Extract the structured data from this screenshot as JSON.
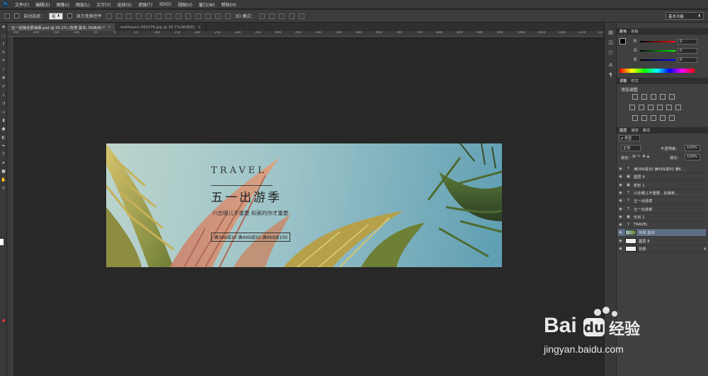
{
  "menubar": {
    "items": [
      "文件(F)",
      "编辑(E)",
      "图像(I)",
      "图层(L)",
      "文字(Y)",
      "选择(S)",
      "滤镜(T)",
      "3D(D)",
      "视图(V)",
      "窗口(W)",
      "帮助(H)"
    ]
  },
  "options_bar": {
    "auto_select_label": "自动选择：",
    "auto_select_value": "组",
    "show_transform_label": "显示变换控件",
    "mode_3d_label": "3D 模式：",
    "workspace": "基本功能"
  },
  "tabs": [
    {
      "label": "五一促销全屏海报.psd @ 55.1% (背景 副本, RGB/8) *",
      "active": true
    },
    {
      "label": "wallhaven-563276.jpg @ 16.7%(RGB/8)",
      "active": false
    }
  ],
  "ruler_ticks": [
    "250",
    "200",
    "150",
    "100",
    "50",
    "0",
    "50",
    "100",
    "150",
    "200",
    "250",
    "300",
    "350",
    "400",
    "450",
    "500",
    "550",
    "600",
    "650",
    "700",
    "750",
    "800",
    "850",
    "900",
    "950",
    "1000",
    "1050",
    "1100",
    "1150",
    "1200"
  ],
  "banner": {
    "travel": "TRAVEL",
    "title": "五一出游季",
    "subtitle": "川志哪儿不重要 和美的你才重要",
    "promo": "满399减30 满499减50 满699减100"
  },
  "panels": {
    "color_tabs": [
      "颜色",
      "色板"
    ],
    "rgb": [
      {
        "label": "R",
        "value": "0"
      },
      {
        "label": "G",
        "value": "0"
      },
      {
        "label": "B",
        "value": "0"
      }
    ],
    "adjust_tabs": [
      "调整",
      "样式"
    ],
    "adjust_title": "添加调整",
    "layers_tabs": [
      "图层",
      "通道",
      "路径"
    ],
    "filter_label": "类型",
    "blend_mode": "正常",
    "opacity_label": "不透明度：",
    "opacity_value": "100%",
    "lock_label": "锁定：",
    "fill_label": "填充：",
    "fill_value": "100%",
    "layers": [
      {
        "type": "T",
        "name": "满399减30 满499减50 满6...",
        "selected": false
      },
      {
        "type": "▣",
        "name": "图层 9",
        "selected": false
      },
      {
        "type": "▣",
        "name": "矩形 1",
        "selected": false
      },
      {
        "type": "T",
        "name": "川去哪儿不重要，扮美新...",
        "selected": false
      },
      {
        "type": "T",
        "name": "五一出游季",
        "selected": false
      },
      {
        "type": "T",
        "name": "五一出游季",
        "selected": false
      },
      {
        "type": "▣",
        "name": "形状 1",
        "selected": false
      },
      {
        "type": "T",
        "name": "TRAVEL",
        "selected": false
      },
      {
        "type": "img",
        "name": "背景 副本",
        "selected": true
      },
      {
        "type": "img",
        "name": "图层 8",
        "selected": false
      },
      {
        "type": "img",
        "name": "背景",
        "selected": false
      }
    ]
  },
  "watermark": {
    "brand": "Bai",
    "brand2": "经验",
    "url": "jingyan.baidu.com"
  }
}
